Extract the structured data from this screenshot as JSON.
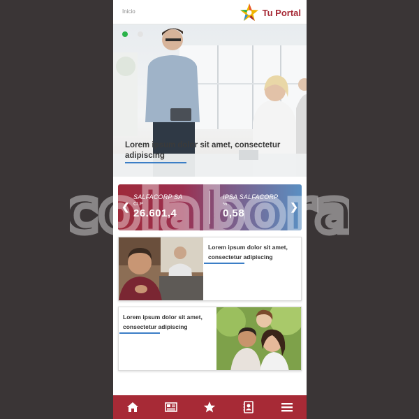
{
  "header": {
    "breadcrumb": "Inicio",
    "brand_name": "Tu Portal",
    "brand_color": "#a72a36"
  },
  "hero": {
    "title": "Lorem ipsum dolor sit amet, consectetur adipiscing",
    "slides": 2,
    "active_slide": 1,
    "active_dot_color": "#2bb34a"
  },
  "ticker": {
    "items": [
      {
        "name": "SALFACORP SA",
        "currency": "CLP",
        "value": "26.601,4"
      },
      {
        "name": "IPSA SALFACORP",
        "currency": "%",
        "value": "0,58"
      }
    ],
    "prev_icon": "chevron-left-icon",
    "next_icon": "chevron-right-icon"
  },
  "cards": [
    {
      "text": "Lorem ipsum dolor sit amet, consectetur adipiscing"
    },
    {
      "text": "Lorem ipsum dolor sit amet, consectetur adipiscing"
    }
  ],
  "bottom_nav": {
    "items": [
      "home-icon",
      "newspaper-icon",
      "star-icon",
      "contact-card-icon",
      "menu-icon"
    ],
    "background": "#a72a36"
  },
  "watermark": {
    "text": "colabora"
  }
}
